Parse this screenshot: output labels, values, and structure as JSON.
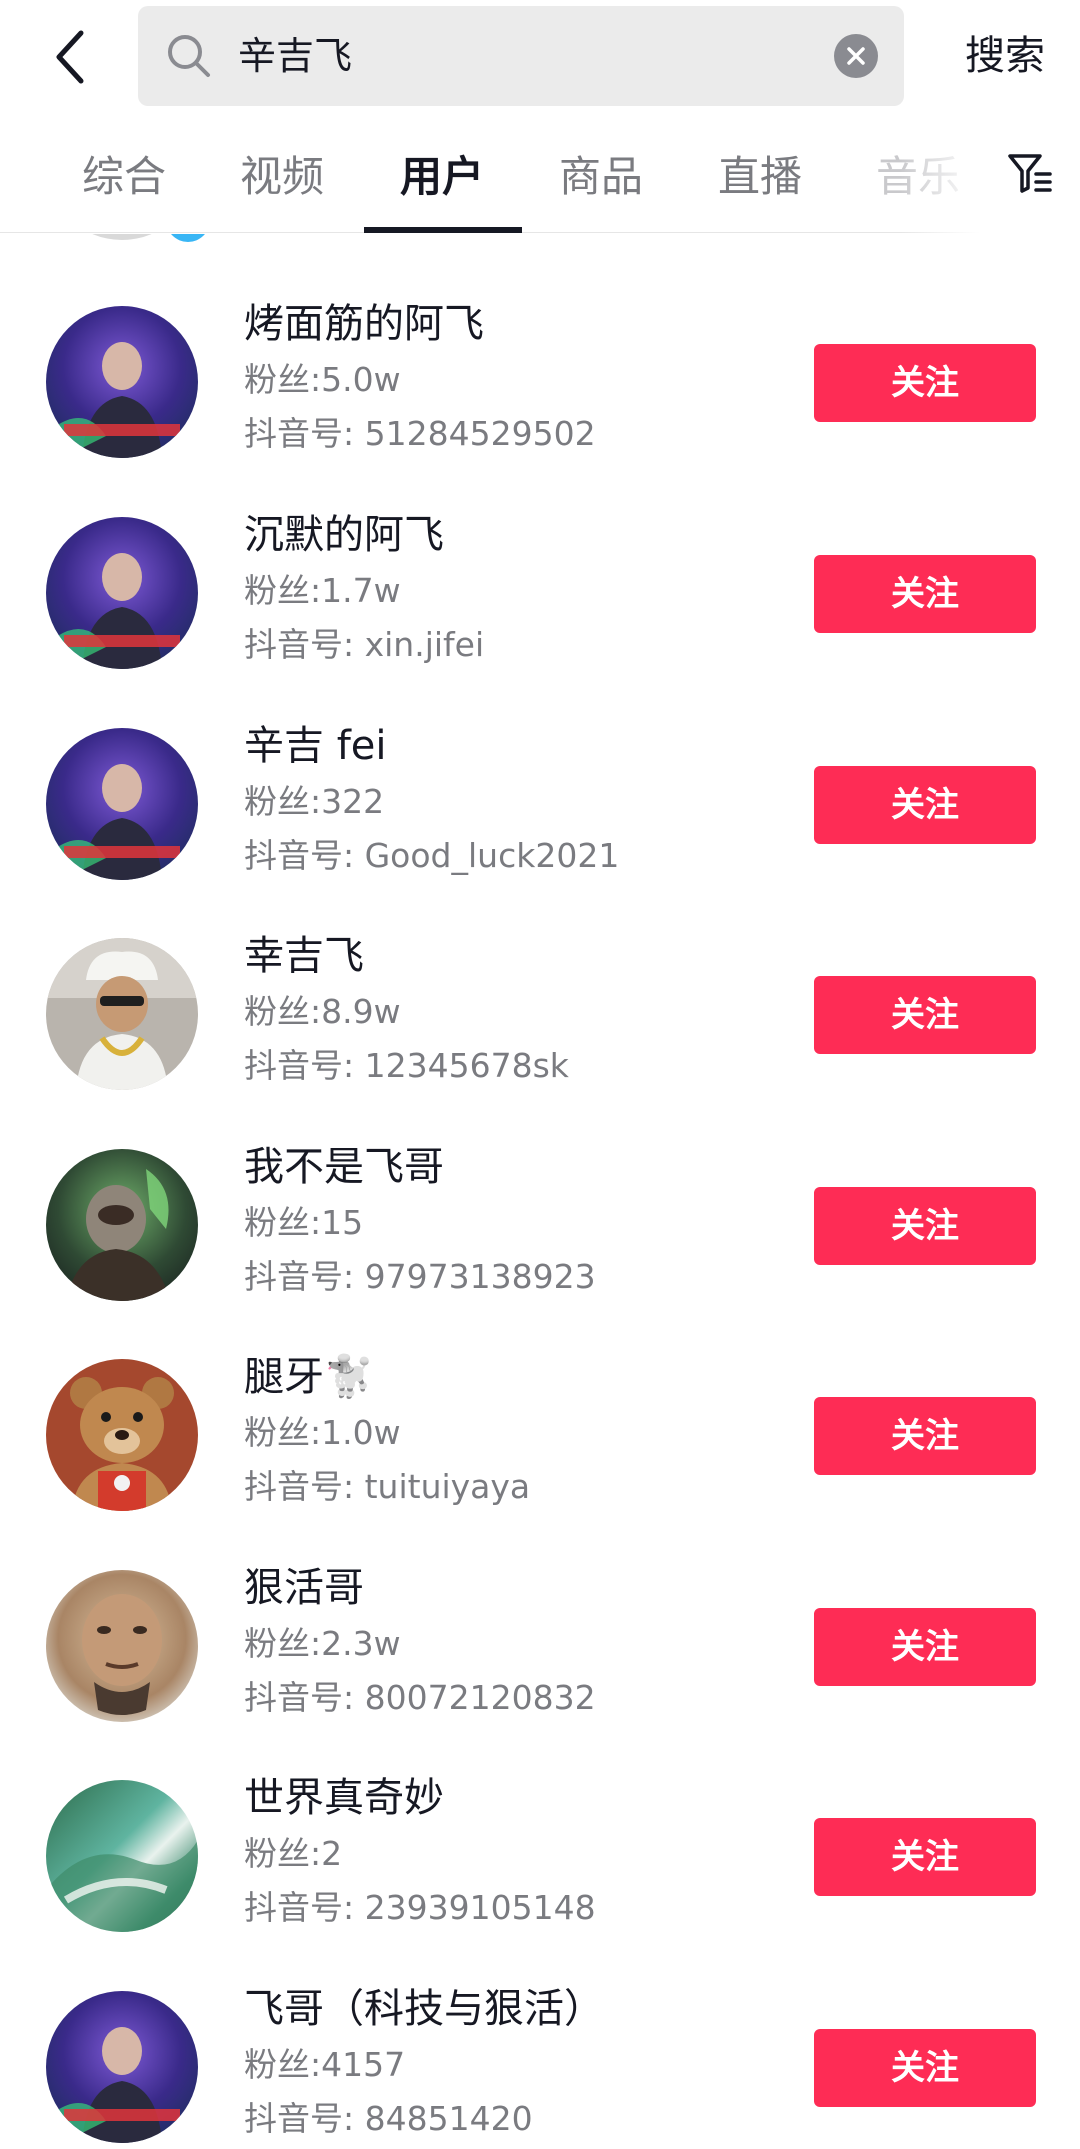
{
  "search": {
    "query": "辛吉飞",
    "button_label": "搜索"
  },
  "tabs": [
    {
      "label": "综合"
    },
    {
      "label": "视频"
    },
    {
      "label": "用户",
      "active": true
    },
    {
      "label": "商品"
    },
    {
      "label": "直播"
    },
    {
      "label": "音乐"
    }
  ],
  "users": [
    {
      "name": "烤面筋的阿飞",
      "fans": "粉丝:5.0w",
      "douyin_id": "抖音号: 51284529502",
      "follow_label": "关注",
      "avatar": "purple-mage-avatar"
    },
    {
      "name": "沉默的阿飞",
      "fans": "粉丝:1.7w",
      "douyin_id": "抖音号: xin.jifei",
      "follow_label": "关注",
      "avatar": "purple-mage-avatar"
    },
    {
      "name": "辛吉 fei",
      "fans": "粉丝:322",
      "douyin_id": "抖音号: Good_luck2021",
      "follow_label": "关注",
      "avatar": "purple-mage-avatar"
    },
    {
      "name": "幸吉飞",
      "fans": "粉丝:8.9w",
      "douyin_id": "抖音号: 12345678sk",
      "follow_label": "关注",
      "avatar": "chef-avatar"
    },
    {
      "name": "我不是飞哥",
      "fans": "粉丝:15",
      "douyin_id": "抖音号: 97973138923",
      "follow_label": "关注",
      "avatar": "game-hero-avatar"
    },
    {
      "name": "腿牙🐩",
      "fans": "粉丝:1.0w",
      "douyin_id": "抖音号: tuituiyaya",
      "follow_label": "关注",
      "avatar": "teddy-bear-avatar"
    },
    {
      "name": "狠活哥",
      "fans": "粉丝:2.3w",
      "douyin_id": "抖音号: 80072120832",
      "follow_label": "关注",
      "avatar": "man-face-avatar"
    },
    {
      "name": "世界真奇妙",
      "fans": "粉丝:2",
      "douyin_id": "抖音号: 23939105148",
      "follow_label": "关注",
      "avatar": "ocean-wave-avatar"
    },
    {
      "name": "飞哥（科技与狠活）",
      "fans": "粉丝:4157",
      "douyin_id": "抖音号: 84851420",
      "follow_label": "关注",
      "avatar": "purple-mage-avatar"
    }
  ],
  "colors": {
    "accent": "#fe2c55",
    "text_primary": "#161823",
    "text_secondary": "#7a7b80",
    "search_bg": "#ebebeb"
  }
}
